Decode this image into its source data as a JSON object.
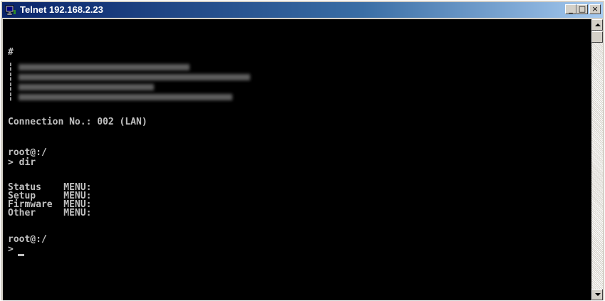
{
  "window": {
    "title": "Telnet 192.168.2.23",
    "minimize_glyph": "_",
    "maximize_glyph": "□",
    "close_glyph": "×"
  },
  "console": {
    "lines": [
      "#",
      "¦",
      "¦",
      "¦",
      "¦",
      "Connection No.: 002 (LAN)",
      "root@:/",
      "> dir",
      "Status    MENU:",
      "Setup     MENU:",
      "Firmware  MENU:",
      "Other     MENU:",
      "root@:/",
      ">"
    ]
  },
  "colors": {
    "title_gradient_start": "#0a246a",
    "title_gradient_end": "#a6caf0",
    "console_background": "#000000",
    "console_text": "#c0c0c0"
  },
  "icons": {
    "title": "telnet-icon",
    "scroll_up": "arrow-up-icon",
    "scroll_down": "arrow-down-icon"
  }
}
